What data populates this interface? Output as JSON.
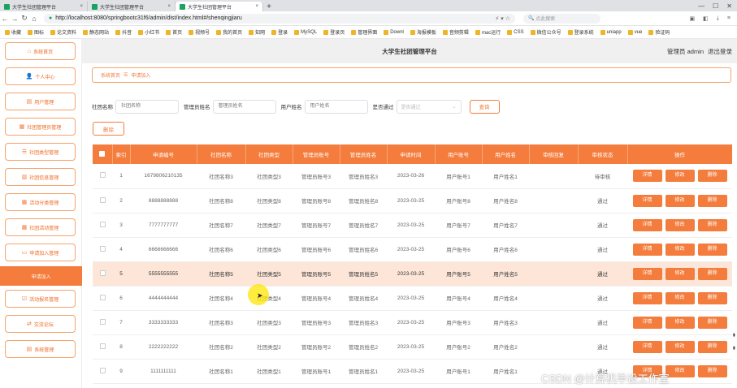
{
  "browser": {
    "tabs": [
      {
        "title": "大学生社团管理平台",
        "active": false
      },
      {
        "title": "大学生社团管理平台",
        "active": false
      },
      {
        "title": "大学生社团管理平台",
        "active": true
      }
    ],
    "new_tab": "+",
    "url": "http://localhost:8080/springbootc31f6/admin/dist/index.html#/shenqingjiaru",
    "search_placeholder": "点此搜索",
    "bookmarks": [
      "收藏",
      "图标",
      "论文资料",
      "静态网站",
      "抖音",
      "小红书",
      "首页",
      "视频号",
      "我的首页",
      "知网",
      "登录",
      "MySQL",
      "登录页",
      "管理界面",
      "Downl",
      "海报模板",
      "音频剪辑",
      "mac运行",
      "CSS",
      "微信公众号",
      "登录系统",
      "uniapp",
      "vue",
      "验证码"
    ]
  },
  "header": {
    "title": "大学生社团管理平台",
    "user_label": "管理员 admin",
    "logout": "退出登录"
  },
  "sidebar": {
    "items": [
      {
        "label": "系统首页",
        "icon": "home-icon",
        "glyph": "⌂"
      },
      {
        "label": "个人中心",
        "icon": "user-icon",
        "glyph": "👤"
      },
      {
        "label": "用户管理",
        "icon": "users-icon",
        "glyph": "▤"
      },
      {
        "label": "社团管理员管理",
        "icon": "grid-icon",
        "glyph": "▦"
      },
      {
        "label": "社团类型管理",
        "icon": "list-icon",
        "glyph": "☰"
      },
      {
        "label": "社团信息管理",
        "icon": "chart-icon",
        "glyph": "▥"
      },
      {
        "label": "活动分类管理",
        "icon": "grid-icon",
        "glyph": "▦"
      },
      {
        "label": "社团活动管理",
        "icon": "grid-icon",
        "glyph": "▦"
      },
      {
        "label": "申请加入管理",
        "icon": "monitor-icon",
        "glyph": "▭"
      },
      {
        "label": "申请加入",
        "icon": "",
        "glyph": ""
      },
      {
        "label": "活动报名管理",
        "icon": "check-icon",
        "glyph": "☑"
      },
      {
        "label": "交流论坛",
        "icon": "forum-icon",
        "glyph": "⇄"
      },
      {
        "label": "系统管理",
        "icon": "settings-icon",
        "glyph": "▤"
      }
    ]
  },
  "breadcrumb": {
    "home": "系统首页",
    "sep": "☰",
    "current": "申请加入"
  },
  "filters": {
    "club_name_label": "社团名称",
    "club_name_placeholder": "社团名称",
    "manager_name_label": "管理员姓名",
    "manager_name_placeholder": "管理员姓名",
    "user_name_label": "用户姓名",
    "user_name_placeholder": "用户姓名",
    "passed_label": "是否通过",
    "passed_placeholder": "是否通过",
    "query_button": "查询"
  },
  "actions": {
    "delete_button": "删除"
  },
  "table": {
    "columns": [
      "",
      "索引",
      "申请编号",
      "社团名称",
      "社团类型",
      "管理员账号",
      "管理员姓名",
      "申请时间",
      "用户账号",
      "用户姓名",
      "审核回复",
      "审核状态",
      "操作"
    ],
    "op_labels": [
      "详情",
      "修改",
      "删除"
    ],
    "rows": [
      {
        "index": "1",
        "no": "1679806210135",
        "club": "社团名称3",
        "type": "社团类型3",
        "acct": "管理员账号3",
        "mgr": "管理员姓名3",
        "time": "2023-03-26",
        "user_acct": "用户账号1",
        "user_name": "用户姓名1",
        "reply": "",
        "status": "待审核",
        "highlight": false
      },
      {
        "index": "2",
        "no": "8888888888",
        "club": "社团名称8",
        "type": "社团类型8",
        "acct": "管理员账号8",
        "mgr": "管理员姓名8",
        "time": "2023-03-25",
        "user_acct": "用户账号8",
        "user_name": "用户姓名8",
        "reply": "",
        "status": "通过",
        "highlight": false
      },
      {
        "index": "3",
        "no": "7777777777",
        "club": "社团名称7",
        "type": "社团类型7",
        "acct": "管理员账号7",
        "mgr": "管理员姓名7",
        "time": "2023-03-25",
        "user_acct": "用户账号7",
        "user_name": "用户姓名7",
        "reply": "",
        "status": "通过",
        "highlight": false
      },
      {
        "index": "4",
        "no": "6666666666",
        "club": "社团名称6",
        "type": "社团类型6",
        "acct": "管理员账号6",
        "mgr": "管理员姓名6",
        "time": "2023-03-25",
        "user_acct": "用户账号6",
        "user_name": "用户姓名6",
        "reply": "",
        "status": "通过",
        "highlight": false
      },
      {
        "index": "5",
        "no": "5555555555",
        "club": "社团名称5",
        "type": "社团类型5",
        "acct": "管理员账号5",
        "mgr": "管理员姓名5",
        "time": "2023-03-25",
        "user_acct": "用户账号5",
        "user_name": "用户姓名5",
        "reply": "",
        "status": "通过",
        "highlight": true
      },
      {
        "index": "6",
        "no": "4444444444",
        "club": "社团名称4",
        "type": "社团类型4",
        "acct": "管理员账号4",
        "mgr": "管理员姓名4",
        "time": "2023-03-25",
        "user_acct": "用户账号4",
        "user_name": "用户姓名4",
        "reply": "",
        "status": "通过",
        "highlight": false
      },
      {
        "index": "7",
        "no": "3333333333",
        "club": "社团名称3",
        "type": "社团类型3",
        "acct": "管理员账号3",
        "mgr": "管理员姓名3",
        "time": "2023-03-25",
        "user_acct": "用户账号3",
        "user_name": "用户姓名3",
        "reply": "",
        "status": "通过",
        "highlight": false
      },
      {
        "index": "8",
        "no": "2222222222",
        "club": "社团名称2",
        "type": "社团类型2",
        "acct": "管理员账号2",
        "mgr": "管理员姓名2",
        "time": "2023-03-25",
        "user_acct": "用户账号2",
        "user_name": "用户姓名2",
        "reply": "",
        "status": "通过",
        "highlight": false
      },
      {
        "index": "9",
        "no": "1111111111",
        "club": "社团名称1",
        "type": "社团类型1",
        "acct": "管理员账号1",
        "mgr": "管理员姓名1",
        "time": "2023-03-25",
        "user_acct": "用户账号1",
        "user_name": "用户姓名1",
        "reply": "",
        "status": "通过",
        "highlight": false
      }
    ]
  },
  "watermark": "CSDN @计算机毕设工作室",
  "colors": {
    "accent": "#f47c3c",
    "highlight_row": "#fde6d8"
  }
}
